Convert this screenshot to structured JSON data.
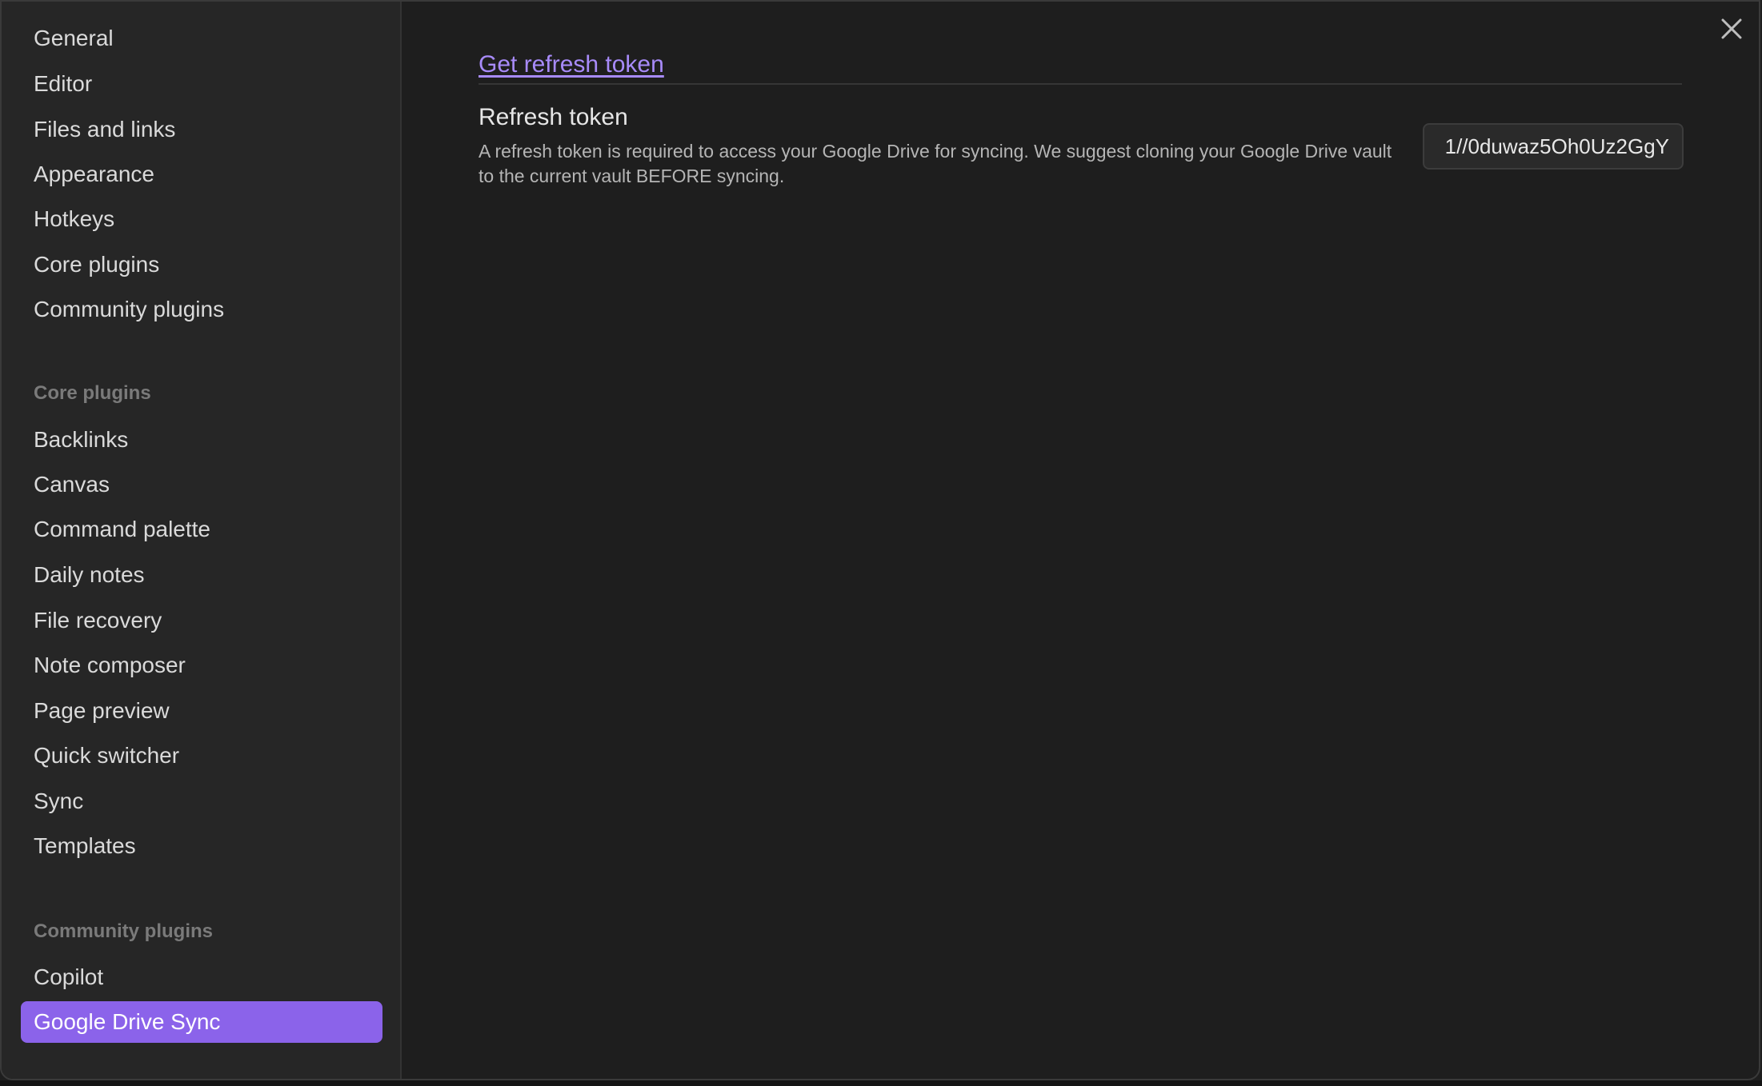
{
  "sidebar": {
    "options": [
      {
        "label": "General"
      },
      {
        "label": "Editor"
      },
      {
        "label": "Files and links"
      },
      {
        "label": "Appearance"
      },
      {
        "label": "Hotkeys"
      },
      {
        "label": "Core plugins"
      },
      {
        "label": "Community plugins"
      }
    ],
    "core_plugins_header": "Core plugins",
    "core_plugins": [
      {
        "label": "Backlinks"
      },
      {
        "label": "Canvas"
      },
      {
        "label": "Command palette"
      },
      {
        "label": "Daily notes"
      },
      {
        "label": "File recovery"
      },
      {
        "label": "Note composer"
      },
      {
        "label": "Page preview"
      },
      {
        "label": "Quick switcher"
      },
      {
        "label": "Sync"
      },
      {
        "label": "Templates"
      }
    ],
    "community_plugins_header": "Community plugins",
    "community_plugins": [
      {
        "label": "Copilot"
      },
      {
        "label": "Google Drive Sync",
        "active": true
      }
    ]
  },
  "content": {
    "link_label": "Get refresh token",
    "setting_name": "Refresh token",
    "setting_description": "A refresh token is required to access your Google Drive for syncing. We suggest cloning your Google Drive vault to the current vault BEFORE syncing.",
    "token_value": "1//0duwaz5Oh0Uz2GgY"
  },
  "icons": {
    "close": "close-icon"
  },
  "colors": {
    "accent": "#8b63ea",
    "link": "#a88bfa",
    "background": "#1e1e1e",
    "sidebar_background": "#262626"
  }
}
